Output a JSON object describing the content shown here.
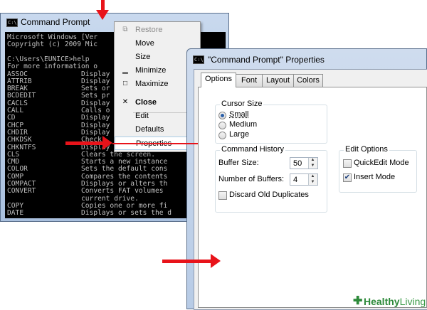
{
  "cmd": {
    "title": "Command Prompt",
    "icon_glyph": "C:\\",
    "lines": [
      {
        "cmd": "Microsoft Windows [Ver",
        "desc": ""
      },
      {
        "cmd": "Copyright (c) 2009 Mic",
        "desc": ""
      },
      {
        "cmd": "",
        "desc": ""
      },
      {
        "cmd": "C:\\Users\\EUNICE>help",
        "desc": ""
      },
      {
        "cmd": "For more information o",
        "desc": ""
      },
      {
        "cmd": "ASSOC",
        "desc": "Display"
      },
      {
        "cmd": "ATTRIB",
        "desc": "Display"
      },
      {
        "cmd": "BREAK",
        "desc": "Sets or"
      },
      {
        "cmd": "BCDEDIT",
        "desc": "Sets pr"
      },
      {
        "cmd": "CACLS",
        "desc": "Display"
      },
      {
        "cmd": "CALL",
        "desc": "Calls o"
      },
      {
        "cmd": "CD",
        "desc": "Display"
      },
      {
        "cmd": "CHCP",
        "desc": "Display"
      },
      {
        "cmd": "CHDIR",
        "desc": "Display"
      },
      {
        "cmd": "CHKDSK",
        "desc": "Check"
      },
      {
        "cmd": "CHKNTFS",
        "desc": "Display"
      },
      {
        "cmd": "CLS",
        "desc": "Clears the screen."
      },
      {
        "cmd": "CMD",
        "desc": "Starts a new instance"
      },
      {
        "cmd": "COLOR",
        "desc": "Sets the default cons"
      },
      {
        "cmd": "COMP",
        "desc": "Compares the contents"
      },
      {
        "cmd": "COMPACT",
        "desc": "Displays or alters th"
      },
      {
        "cmd": "CONVERT",
        "desc": "Converts FAT volumes"
      },
      {
        "cmd": "",
        "desc": "current drive."
      },
      {
        "cmd": "COPY",
        "desc": "Copies one or more fi"
      },
      {
        "cmd": "DATE",
        "desc": "Displays or sets the d"
      }
    ]
  },
  "context_menu": {
    "items": [
      {
        "label": "Restore",
        "icon": "restore-icon",
        "glyph": "⧉",
        "disabled": true
      },
      {
        "label": "Move",
        "icon": "",
        "glyph": "",
        "disabled": false
      },
      {
        "label": "Size",
        "icon": "",
        "glyph": "",
        "disabled": false
      },
      {
        "label": "Minimize",
        "icon": "minimize-icon",
        "glyph": "▁",
        "disabled": false
      },
      {
        "label": "Maximize",
        "icon": "maximize-icon",
        "glyph": "□",
        "disabled": false
      },
      {
        "label": "Close",
        "icon": "close-icon",
        "glyph": "✕",
        "bold": true
      },
      {
        "label": "Edit",
        "icon": "",
        "glyph": ""
      },
      {
        "label": "Defaults",
        "icon": "",
        "glyph": ""
      },
      {
        "label": "Properties",
        "icon": "",
        "glyph": "",
        "highlighted": true
      }
    ]
  },
  "properties": {
    "title": "\"Command Prompt\" Properties",
    "tabs": [
      "Options",
      "Font",
      "Layout",
      "Colors"
    ],
    "active_tab": "Options",
    "cursor_size": {
      "title": "Cursor Size",
      "options": [
        "Small",
        "Medium",
        "Large"
      ],
      "selected": "Small"
    },
    "command_history": {
      "title": "Command History",
      "buffer_size_label": "Buffer Size:",
      "buffer_size": "50",
      "buffers_label": "Number of Buffers:",
      "buffers": "4",
      "discard_label": "Discard Old Duplicates",
      "discard_checked": false
    },
    "edit_options": {
      "title": "Edit Options",
      "quickedit_label": "QuickEdit Mode",
      "quickedit_checked": false,
      "insert_label": "Insert Mode",
      "insert_checked": true
    }
  },
  "logo": {
    "part1": "Healthy",
    "part2": "Living",
    "cross": "✚"
  },
  "colors": {
    "arrow": "#e8131a",
    "logo": "#2d8a3a"
  }
}
